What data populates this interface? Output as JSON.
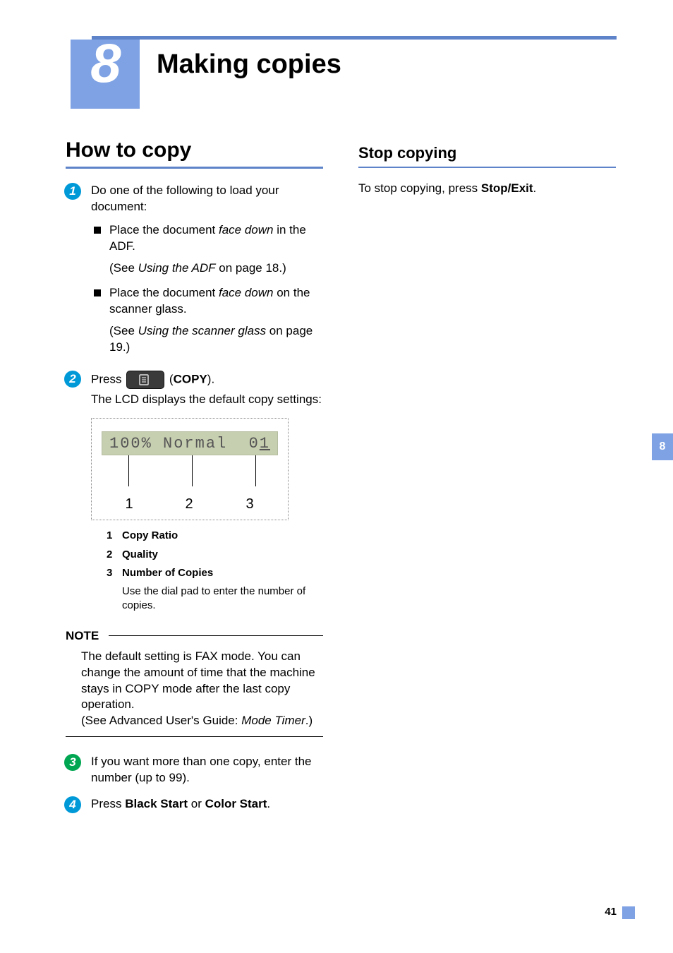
{
  "chapter": {
    "number": "8",
    "title": "Making copies"
  },
  "page_number": "41",
  "side_tab": "8",
  "left": {
    "heading": "How to copy",
    "step1": {
      "intro": "Do one of the following to load your document:",
      "bullet1_a": "Place the document ",
      "bullet1_b_italic": "face down",
      "bullet1_c": " in the ADF.",
      "ref1_a": "(See ",
      "ref1_b_italic": "Using the ADF",
      "ref1_c": " on page 18.)",
      "bullet2_a": "Place the document ",
      "bullet2_b_italic": "face down",
      "bullet2_c": " on the scanner glass.",
      "ref2_a": "(See ",
      "ref2_b_italic": "Using the scanner glass",
      "ref2_c": " on page 19.)"
    },
    "step2": {
      "press": "Press ",
      "copy_label_open": " (",
      "copy_label_bold": "COPY",
      "copy_label_close": ").",
      "after": "The LCD displays the default copy settings:"
    },
    "lcd": {
      "left_text": "100% Normal",
      "right_pre": "0",
      "right_cursor": "1",
      "p1": "1",
      "p2": "2",
      "p3": "3"
    },
    "legend": {
      "n1": "1",
      "l1": "Copy Ratio",
      "n2": "2",
      "l2": "Quality",
      "n3": "3",
      "l3": "Number of Copies",
      "note3": "Use the dial pad to enter the number of copies."
    },
    "note": {
      "label": "NOTE",
      "body_a": "The default setting is FAX mode. You can change the amount of time that the machine stays in COPY mode after the last copy operation.",
      "body_b_pre": "(See Advanced User's Guide: ",
      "body_b_italic": "Mode Timer",
      "body_b_post": ".)"
    },
    "step3": "If you want more than one copy, enter the number (up to 99).",
    "step4_a": "Press ",
    "step4_b_bold": "Black Start",
    "step4_c": " or ",
    "step4_d_bold": "Color Start",
    "step4_e": "."
  },
  "right": {
    "heading": "Stop copying",
    "body_a": "To stop copying, press ",
    "body_b_bold": "Stop/Exit",
    "body_c": "."
  }
}
